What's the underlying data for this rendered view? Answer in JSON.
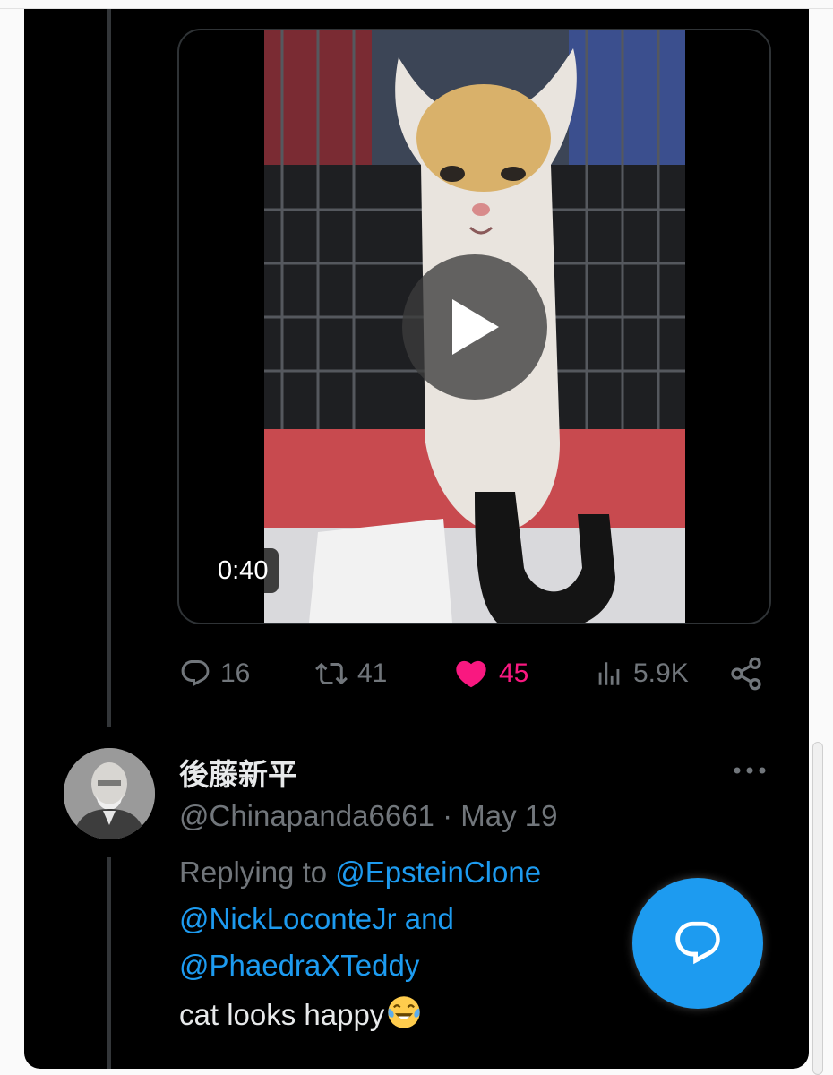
{
  "video": {
    "duration": "0:40",
    "play_icon": "play-icon"
  },
  "actions": {
    "replies": "16",
    "retweets": "41",
    "likes": "45",
    "views": "5.9K",
    "icons": [
      "reply-icon",
      "retweet-icon",
      "heart-icon",
      "views-icon",
      "share-icon"
    ],
    "like_color": "#f91880",
    "muted_color": "#71767b"
  },
  "reply": {
    "display_name": "後藤新平",
    "handle": "@Chinapanda6661",
    "separator": "·",
    "date": "May 19",
    "replying_prefix": "Replying to",
    "mention_1": "@EpsteinClone",
    "mention_2": "@NickLoconteJr",
    "conjunction": "and",
    "mention_3": "@PhaedraXTeddy",
    "text": "cat looks happy",
    "emoji_name": "face-with-tears-of-joy-icon",
    "mention_color": "#1d9bf0"
  },
  "compose_button": {
    "icon": "compose-reply-icon",
    "color": "#1d9bf0"
  }
}
